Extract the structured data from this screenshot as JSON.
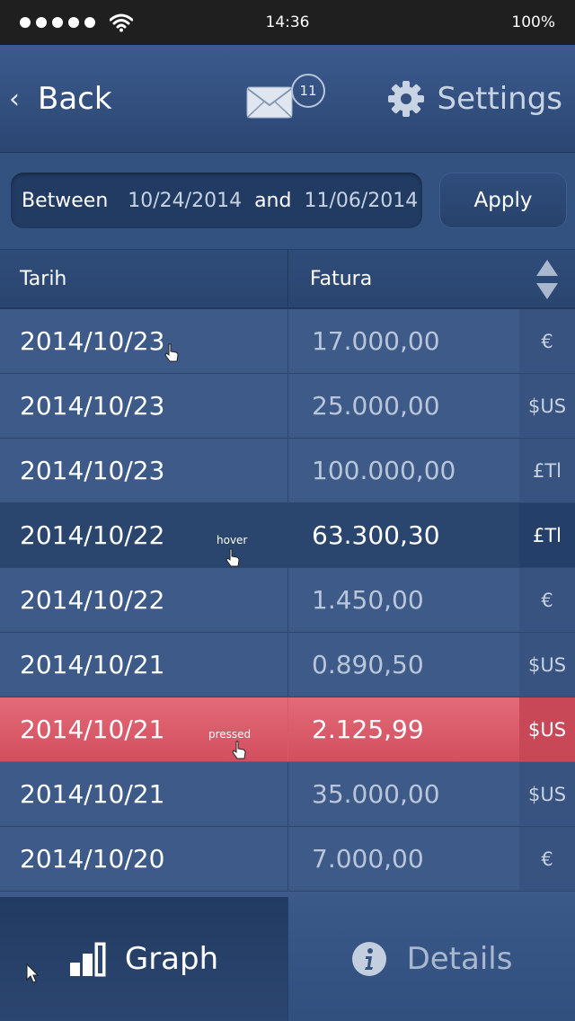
{
  "status_bar": {
    "time": "14:36",
    "battery": "100%"
  },
  "nav": {
    "back_label": "Back",
    "mail_count": "11",
    "settings_label": "Settings"
  },
  "filter": {
    "between_label": "Between",
    "start_date": "10/24/2014",
    "and_label": "and",
    "end_date": "11/06/2014",
    "apply_label": "Apply"
  },
  "table": {
    "columns": {
      "date": "Tarih",
      "amount": "Fatura"
    },
    "rows": [
      {
        "date": "2014/10/23",
        "amount": "17.000,00",
        "currency": "€"
      },
      {
        "date": "2014/10/23",
        "amount": "25.000,00",
        "currency": "$US"
      },
      {
        "date": "2014/10/23",
        "amount": "100.000,00",
        "currency": "£Tl"
      },
      {
        "date": "2014/10/22",
        "amount": "63.300,30",
        "currency": "£Tl",
        "state": "hover"
      },
      {
        "date": "2014/10/22",
        "amount": "1.450,00",
        "currency": "€"
      },
      {
        "date": "2014/10/21",
        "amount": "0.890,50",
        "currency": "$US"
      },
      {
        "date": "2014/10/21",
        "amount": "2.125,99",
        "currency": "$US",
        "state": "pressed"
      },
      {
        "date": "2014/10/21",
        "amount": "35.000,00",
        "currency": "$US"
      },
      {
        "date": "2014/10/20",
        "amount": "7.000,00",
        "currency": "€"
      }
    ]
  },
  "bottom_tabs": {
    "graph_label": "Graph",
    "details_label": "Details"
  },
  "colors": {
    "background": "#3d5a8a",
    "pressed_row": "#dc5d6c",
    "hover_row": "#2a456e",
    "status_bar": "#1f1f1f"
  },
  "icons": [
    "wifi-icon",
    "chevron-left-icon",
    "mail-icon",
    "gear-icon",
    "sort-icon",
    "cursor-icon",
    "bar-chart-icon",
    "info-icon"
  ]
}
